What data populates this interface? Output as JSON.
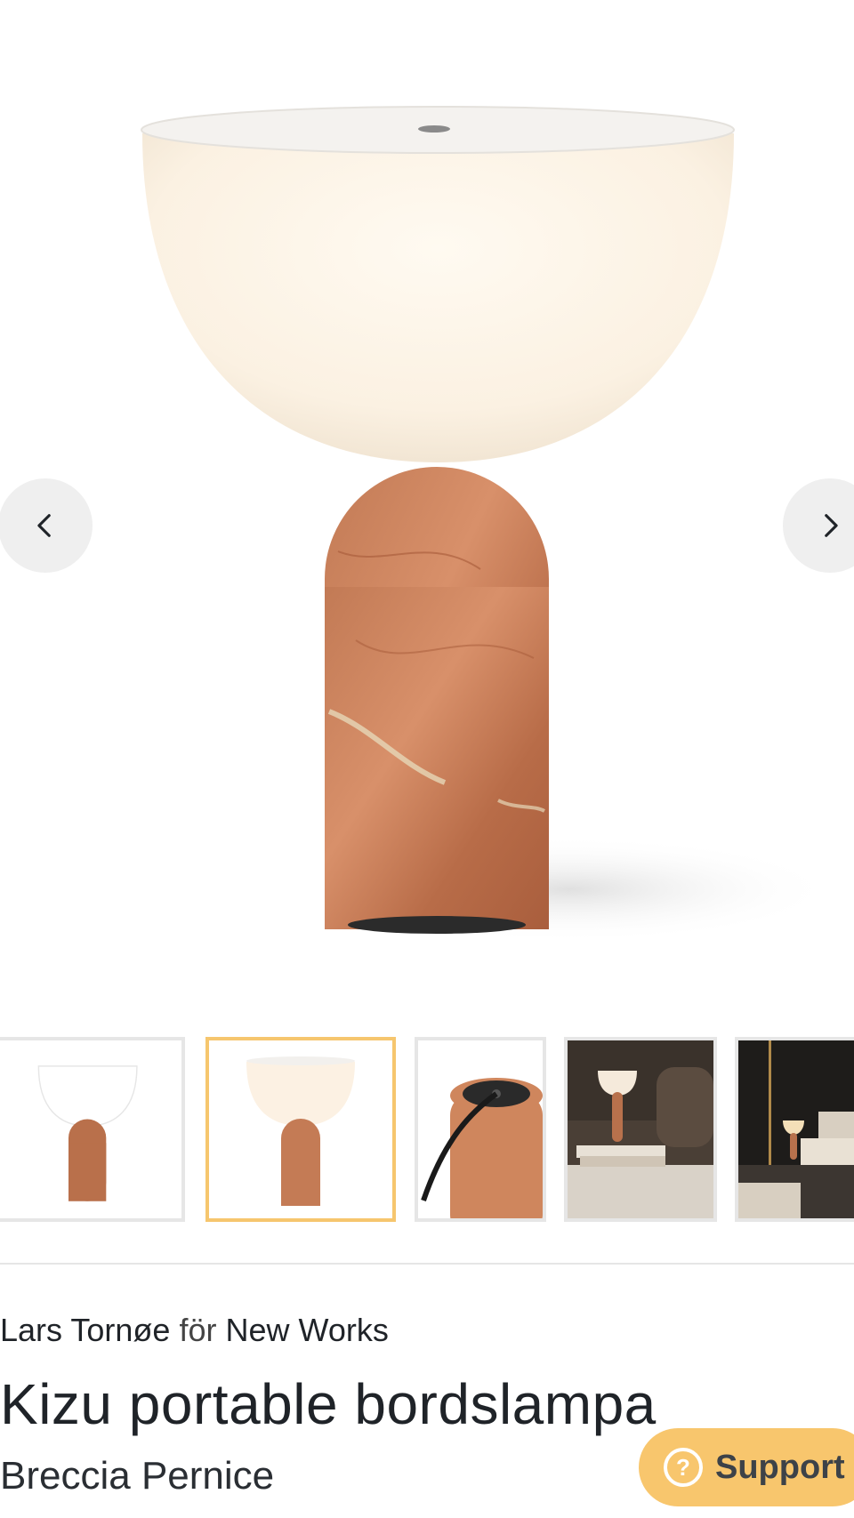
{
  "gallery": {
    "prev_icon": "chevron-left-icon",
    "next_icon": "chevron-right-icon",
    "thumbnails": [
      {
        "name": "thumbnail-white-shade",
        "active": false
      },
      {
        "name": "thumbnail-opal-shade",
        "active": true
      },
      {
        "name": "thumbnail-charging-port",
        "active": false
      },
      {
        "name": "thumbnail-lifestyle-table",
        "active": false
      },
      {
        "name": "thumbnail-lifestyle-stairs",
        "active": false
      }
    ]
  },
  "product": {
    "designer": "Lars Tornøe",
    "connector": "för",
    "brand": "New Works",
    "title": "Kizu portable bordslampa",
    "variant": "Breccia Pernice"
  },
  "support": {
    "label": "Support",
    "icon": "question-circle-icon",
    "icon_glyph": "?"
  },
  "colors": {
    "accent": "#f8c66d",
    "active_thumb_border": "#f6c66e",
    "text": "#1f2328"
  }
}
